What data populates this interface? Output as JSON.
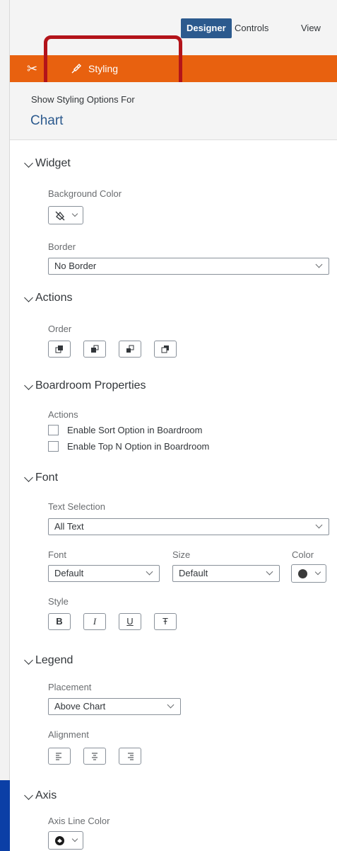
{
  "topbar": {
    "tabs": [
      "Designer",
      "Controls",
      "View"
    ]
  },
  "panel": {
    "tab_label": "Styling",
    "show_for_label": "Show Styling Options For",
    "show_for_value": "Chart"
  },
  "widget": {
    "title": "Widget",
    "bg_color_label": "Background Color",
    "border_label": "Border",
    "border_value": "No Border"
  },
  "actions": {
    "title": "Actions",
    "order_label": "Order"
  },
  "boardroom": {
    "title": "Boardroom Properties",
    "actions_label": "Actions",
    "options": [
      "Enable Sort Option in Boardroom",
      "Enable Top N Option in Boardroom"
    ]
  },
  "font": {
    "title": "Font",
    "text_selection_label": "Text Selection",
    "text_selection_value": "All Text",
    "font_label": "Font",
    "font_value": "Default",
    "size_label": "Size",
    "size_value": "Default",
    "color_label": "Color",
    "style_label": "Style",
    "style_buttons": [
      "B",
      "I",
      "U",
      "Ŧ"
    ]
  },
  "legend": {
    "title": "Legend",
    "placement_label": "Placement",
    "placement_value": "Above Chart",
    "alignment_label": "Alignment"
  },
  "axis": {
    "title": "Axis",
    "line_color_label": "Axis Line Color"
  },
  "colors": {
    "accent_orange": "#e8610f",
    "designer_blue": "#2c5a8e",
    "highlight_red": "#b3141a"
  }
}
